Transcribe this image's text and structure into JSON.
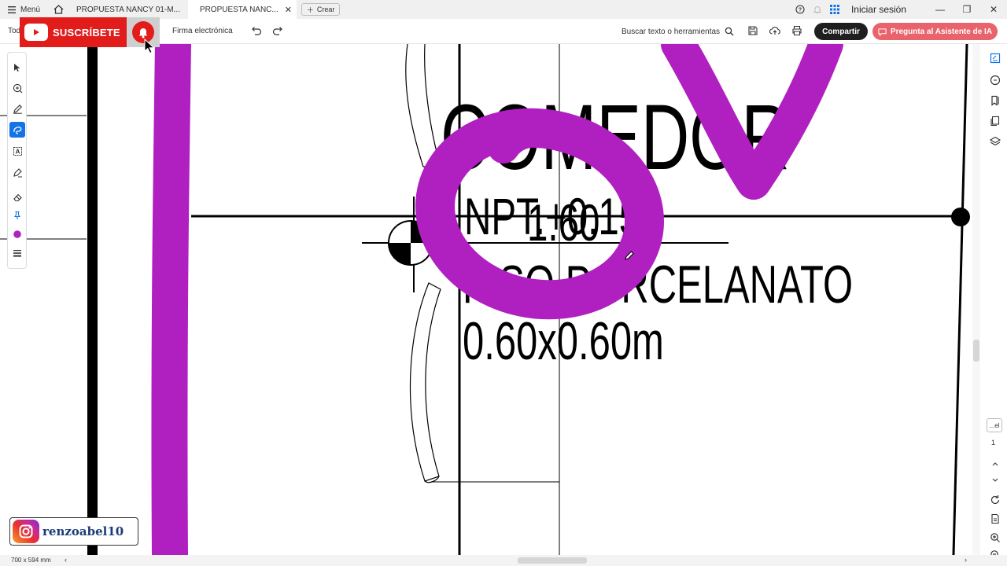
{
  "tabbar": {
    "menu_label": "Menú",
    "tabs": [
      {
        "label": "PROPUESTA NANCY 01-M...",
        "active": false
      },
      {
        "label": "PROPUESTA NANC...",
        "active": true
      }
    ],
    "create_label": "Crear",
    "login_label": "Iniciar sesión"
  },
  "toolbar": {
    "left_text": "Tod",
    "signature_label": "Firma electrónica",
    "search_label": "Buscar texto o herramientas",
    "share_label": "Compartir",
    "ai_label": "Pregunta al Asistente de IA"
  },
  "overlay": {
    "subscribe_label": "SUSCRÍBETE",
    "instagram_handle": "renzoabel10"
  },
  "drawing": {
    "room_name": "COMEDOR",
    "level_label": "NPT.+0.15",
    "level_value": "1.60",
    "floor_finish": "PISO PORCELANATO",
    "tile_size": "0.60x0.60m",
    "annotation_color": "#b020c0"
  },
  "navigation": {
    "page_box": "...el",
    "page_number": "1"
  },
  "status": {
    "page_size": "700 x 594 mm"
  },
  "colors": {
    "accent_blue": "#1473e6",
    "share_bg": "#1f1f1f",
    "ai_bg": "#e8636c",
    "youtube_red": "#e21b1b"
  }
}
